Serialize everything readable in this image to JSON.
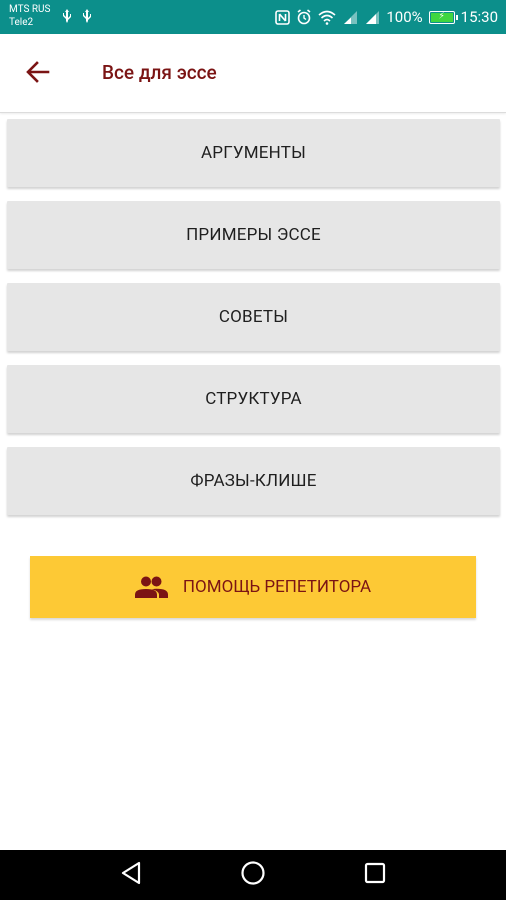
{
  "status_bar": {
    "carrier_primary": "MTS RUS",
    "carrier_secondary": "Tele2",
    "battery_percent": "100%",
    "battery_level": 1.0,
    "time": "15:30",
    "background_color": "#0c8f8b",
    "icons": [
      "usb-icon",
      "usb-icon",
      "nfc-icon",
      "alarm-icon",
      "wifi-icon",
      "signal-icon",
      "signal-icon",
      "battery-charging-icon"
    ]
  },
  "app_bar": {
    "title": "Все для эссе",
    "title_color": "#7b1414",
    "back_icon": "arrow-back-icon"
  },
  "menu": {
    "items": [
      {
        "label": "АРГУМЕНТЫ"
      },
      {
        "label": "ПРИМЕРЫ ЭССЕ"
      },
      {
        "label": "СОВЕТЫ"
      },
      {
        "label": "СТРУКТУРА"
      },
      {
        "label": "ФРАЗЫ-КЛИШЕ"
      }
    ],
    "item_background": "#e6e6e6"
  },
  "tutor_button": {
    "label": "ПОМОЩЬ РЕПЕТИТОРА",
    "icon": "group-icon",
    "background": "#fdc935",
    "text_color": "#7b1414"
  },
  "nav_bar": {
    "buttons": [
      "back-triangle-icon",
      "home-circle-icon",
      "recents-square-icon"
    ]
  }
}
